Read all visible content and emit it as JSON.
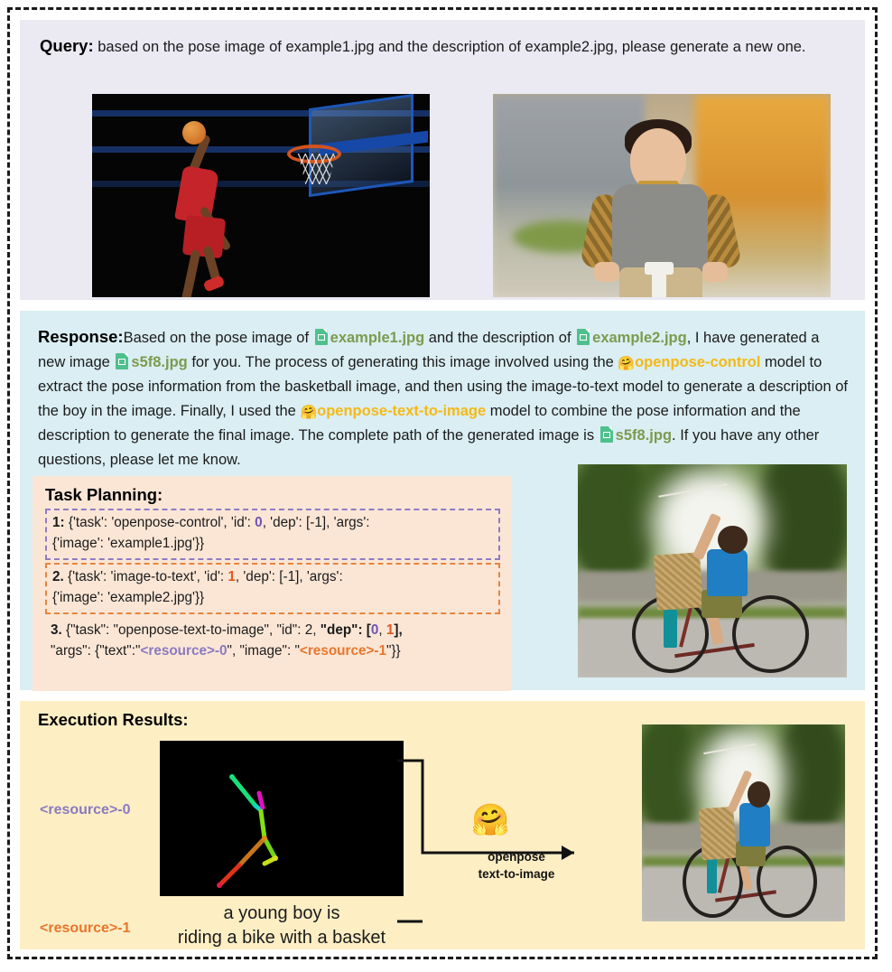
{
  "query": {
    "label": "Query:",
    "text": " based on the pose image of example1.jpg and the description of example2.jpg, please generate a new one.",
    "images": [
      {
        "name": "basketball-dunk-image",
        "alt": "basketball player dunking"
      },
      {
        "name": "boy-on-scooter-image",
        "alt": "young boy on a scooter"
      }
    ]
  },
  "response": {
    "label": "Response:",
    "seg1": "Based on the pose image of ",
    "file1": "example1.jpg",
    "seg2": " and the description of ",
    "file2": "example2.jpg",
    "seg3": ", I have generated a new image ",
    "file3": "s5f8.jpg",
    "seg4": " for you. The process of generating this image involved using the ",
    "model1": "openpose-control",
    "seg5": " model to extract the pose information from the basketball image, and then using the image-to-text model to generate a description of the boy in the image. Finally, I used the ",
    "model2": "openpose-text-to-image",
    "seg6": " model to combine the pose information and the description to generate the final image. The complete path of the generated image is ",
    "file4": "s5f8.jpg",
    "seg7": ". If you have any other questions, please let me know.",
    "generated_image_alt": "boy riding a bike with a basket"
  },
  "task_planning": {
    "title": "Task Planning:",
    "tasks": [
      {
        "num": "1:",
        "line1_a": " {'task': 'openpose-control', 'id': ",
        "id": "0",
        "line1_b": ", 'dep': [-1], 'args':",
        "line2": "{'image': 'example1.jpg'}}",
        "border_color": "#8f7cc4"
      },
      {
        "num": "2.",
        "line1_a": " {'task': 'image-to-text', 'id': ",
        "id": "1",
        "line1_b": ", 'dep': [-1], 'args':",
        "line2": "{'image': 'example2.jpg'}}",
        "border_color": "#e8843a"
      }
    ],
    "task3": {
      "num": "3.",
      "a": " {\"task\": \"openpose-text-to-image\", \"id\": 2, ",
      "dep_key": "\"dep\"",
      "b": ": [",
      "dep0": "0",
      "comma": ", ",
      "dep1": "1",
      "c": "],",
      "line2_a": "\"args\": {\"text\":\"",
      "res0": "<resource>-0",
      "line2_b": "\", \"image\": \"",
      "res1": "<resource>-1",
      "line2_c": "\"}}"
    }
  },
  "execution": {
    "title": "Execution Results:",
    "resource0_label": "<resource>-0",
    "resource1_label": "<resource>-1",
    "caption_line1": "a young boy is",
    "caption_line2": "riding a bike with a basket",
    "arrow_label_line1": "openpose",
    "arrow_label_line2": "text-to-image",
    "hf_icon": "🤗",
    "pose_image_alt": "openpose skeleton on black background",
    "final_image_alt": "boy riding a bike with a basket"
  },
  "colors": {
    "query_bg": "#ebe9f2",
    "response_bg": "#daeef3",
    "task_bg": "#fbe6d6",
    "exec_bg": "#fdeec4",
    "filename_green": "#7e9a4e",
    "model_yellow": "#f5b915",
    "resource0_purple": "#8a7ac0",
    "resource1_orange": "#e8762c",
    "file_icon_green": "#4fc08d"
  }
}
